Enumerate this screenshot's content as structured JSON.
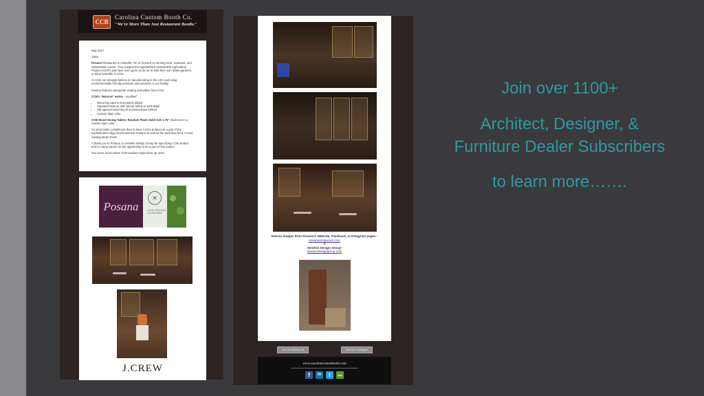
{
  "brand": {
    "logo_text": "CCB",
    "name": "Carolina Custom Booth Co.",
    "tagline": "\"We're More Than Just Restaurant Booths\""
  },
  "letter": {
    "date": "May 2017",
    "greeting": "Juley,",
    "para1_lead": "Posana",
    "para1": "Restaurant in Asheville, NC is focused on serving local, seasonal, and sustainable cuisine. They support the Appalachian Sustainable Agricultural Project (ASAP) and have even gone as far as to start their own urban gardens in West Asheville in 2015.",
    "para2": "At CCB, we strongly believe in manufacturing in the USA and using environmentally friendly products and practices in our facility.",
    "para3": "Posana features banquette seating and tables from CCB.",
    "series_lead": "CCB's \"Monroe\" series",
    "series_suffix": "- modified",
    "bullets": [
      "Wood top caps & end panels added",
      "Standard Monroe ISB: biscuit tufted w/ welt detail",
      "Tall tapered wood leg w/ enclosed base behind",
      "Custom stain color"
    ],
    "tables_lead": "CCB Wood Dining Tables- Random Plank Solid Ash 1.75\"",
    "tables_suffix": "thickness in a custom stain color",
    "para5": "So what better compliment then to have CCB's product as a part of the sophisticated edgy environment at Posana as well as the backdrop for a J Crew catalog photo shoot.",
    "para6": "A thank you to Posana, to Stratton Design Group for specifying CCB product, and to Camp Sartori for the opportunity to be a part of this project.",
    "closing": "You never know where CCB product might show up next!"
  },
  "posana": {
    "wordmark": "Posana",
    "note": "LOCAL SEASONAL SUSTAINABLE"
  },
  "jcrew": {
    "wordmark": "J.CREW"
  },
  "right_card": {
    "caption_line": "Interior images from Posana's Website, Facebook, & Instagram pages -",
    "link1": "posanarestaurant.com",
    "amp": "&",
    "designer": "Stratton Design Group-",
    "link2": "strattondesigngroup.com"
  },
  "buttons": {
    "join": "Join Our Mailing List",
    "send": "Send to a Colleague"
  },
  "footer": {
    "url": "www.carolinacustombooth.com",
    "social": [
      "f",
      "in",
      "t",
      "rss"
    ]
  },
  "cta": {
    "line1": "Join over 1100+",
    "line2": "Architect, Designer, &",
    "line3": "Furniture Dealer Subscribers",
    "line4": "to learn more……."
  }
}
